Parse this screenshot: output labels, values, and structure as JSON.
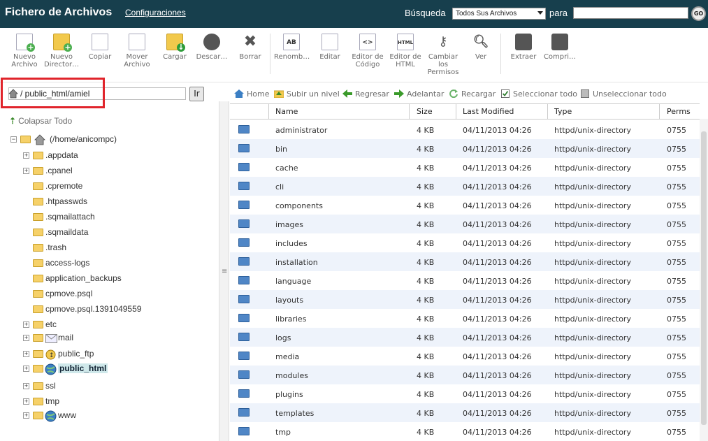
{
  "header": {
    "title": "Fichero de Archivos",
    "settings_link": "Configuraciones",
    "search_label": "Búsqueda",
    "search_scope": "Todos Sus Archivos",
    "for_label": "para",
    "search_value": "",
    "go_label": "GO",
    "bg_color": "#173f4d"
  },
  "toolbar": {
    "items": [
      {
        "label": "Nuevo Archivo",
        "icon": "new-file-icon"
      },
      {
        "label": "Nuevo Director…",
        "icon": "new-folder-icon"
      },
      {
        "label": "Copiar",
        "icon": "copy-icon"
      },
      {
        "label": "Mover Archivo",
        "icon": "move-icon"
      },
      {
        "label": "Cargar",
        "icon": "upload-icon"
      },
      {
        "label": "Descar…",
        "icon": "download-icon"
      },
      {
        "label": "Borrar",
        "icon": "delete-icon"
      },
      {
        "label": "Renomb…",
        "icon": "rename-icon"
      },
      {
        "label": "Editar",
        "icon": "edit-icon"
      },
      {
        "label": "Editor de Código",
        "icon": "code-editor-icon"
      },
      {
        "label": "Editor de HTML",
        "icon": "html-editor-icon"
      },
      {
        "label": "Cambiar los Permisos",
        "icon": "permissions-icon"
      },
      {
        "label": "Ver",
        "icon": "view-icon"
      },
      {
        "label": "Extraer",
        "icon": "extract-icon"
      },
      {
        "label": "Compri…",
        "icon": "compress-icon"
      }
    ]
  },
  "path": {
    "value": "/ public_html/amiel",
    "go_label": "Ir"
  },
  "tree": {
    "collapse_label": "Colapsar Todo",
    "root_label": "(/home/anicompc)",
    "nodes": [
      {
        "label": ".appdata",
        "expandable": true
      },
      {
        "label": ".cpanel",
        "expandable": true
      },
      {
        "label": ".cpremote",
        "expandable": false
      },
      {
        "label": ".htpasswds",
        "expandable": false
      },
      {
        "label": ".sqmailattach",
        "expandable": false
      },
      {
        "label": ".sqmaildata",
        "expandable": false
      },
      {
        "label": ".trash",
        "expandable": false
      },
      {
        "label": "access-logs",
        "expandable": false
      },
      {
        "label": "application_backups",
        "expandable": false
      },
      {
        "label": "cpmove.psql",
        "expandable": false
      },
      {
        "label": "cpmove.psql.1391049559",
        "expandable": false
      },
      {
        "label": "etc",
        "expandable": true
      },
      {
        "label": "mail",
        "expandable": true
      },
      {
        "label": "public_ftp",
        "expandable": true
      },
      {
        "label": "public_html",
        "expandable": true
      },
      {
        "label": "ssl",
        "expandable": true
      },
      {
        "label": "tmp",
        "expandable": true
      },
      {
        "label": "www",
        "expandable": true
      }
    ]
  },
  "nav": {
    "home": "Home",
    "up": "Subir un nivel",
    "back": "Regresar",
    "forward": "Adelantar",
    "reload": "Recargar",
    "select_all": "Seleccionar todo",
    "unselect_all": "Unseleccionar todo"
  },
  "table": {
    "columns": [
      "Name",
      "Size",
      "Last Modified",
      "Type",
      "Perms"
    ],
    "rows": [
      [
        "administrator",
        "4 KB",
        "04/11/2013 04:26",
        "httpd/unix-directory",
        "0755"
      ],
      [
        "bin",
        "4 KB",
        "04/11/2013 04:26",
        "httpd/unix-directory",
        "0755"
      ],
      [
        "cache",
        "4 KB",
        "04/11/2013 04:26",
        "httpd/unix-directory",
        "0755"
      ],
      [
        "cli",
        "4 KB",
        "04/11/2013 04:26",
        "httpd/unix-directory",
        "0755"
      ],
      [
        "components",
        "4 KB",
        "04/11/2013 04:26",
        "httpd/unix-directory",
        "0755"
      ],
      [
        "images",
        "4 KB",
        "04/11/2013 04:26",
        "httpd/unix-directory",
        "0755"
      ],
      [
        "includes",
        "4 KB",
        "04/11/2013 04:26",
        "httpd/unix-directory",
        "0755"
      ],
      [
        "installation",
        "4 KB",
        "04/11/2013 04:26",
        "httpd/unix-directory",
        "0755"
      ],
      [
        "language",
        "4 KB",
        "04/11/2013 04:26",
        "httpd/unix-directory",
        "0755"
      ],
      [
        "layouts",
        "4 KB",
        "04/11/2013 04:26",
        "httpd/unix-directory",
        "0755"
      ],
      [
        "libraries",
        "4 KB",
        "04/11/2013 04:26",
        "httpd/unix-directory",
        "0755"
      ],
      [
        "logs",
        "4 KB",
        "04/11/2013 04:26",
        "httpd/unix-directory",
        "0755"
      ],
      [
        "media",
        "4 KB",
        "04/11/2013 04:26",
        "httpd/unix-directory",
        "0755"
      ],
      [
        "modules",
        "4 KB",
        "04/11/2013 04:26",
        "httpd/unix-directory",
        "0755"
      ],
      [
        "plugins",
        "4 KB",
        "04/11/2013 04:26",
        "httpd/unix-directory",
        "0755"
      ],
      [
        "templates",
        "4 KB",
        "04/11/2013 04:26",
        "httpd/unix-directory",
        "0755"
      ],
      [
        "tmp",
        "4 KB",
        "04/11/2013 04:26",
        "httpd/unix-directory",
        "0755"
      ]
    ]
  }
}
